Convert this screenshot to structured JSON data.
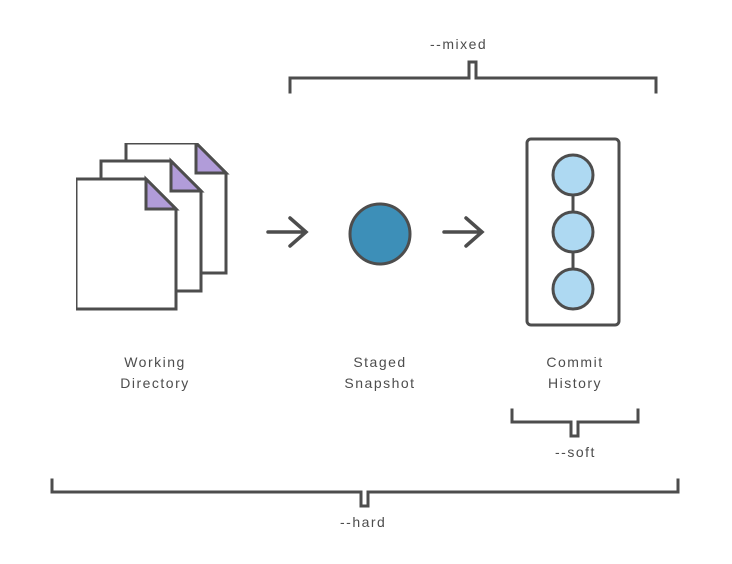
{
  "diagram": {
    "working_directory_label": "Working\nDirectory",
    "staged_snapshot_label": "Staged\nSnapshot",
    "commit_history_label": "Commit\nHistory"
  },
  "flags": {
    "mixed": "--mixed",
    "soft": "--soft",
    "hard": "--hard"
  },
  "colors": {
    "stroke": "#4d4d4d",
    "page_fill": "#b19cd9",
    "staged_fill": "#3d8fb8",
    "commit_fill": "#aed9f2"
  }
}
